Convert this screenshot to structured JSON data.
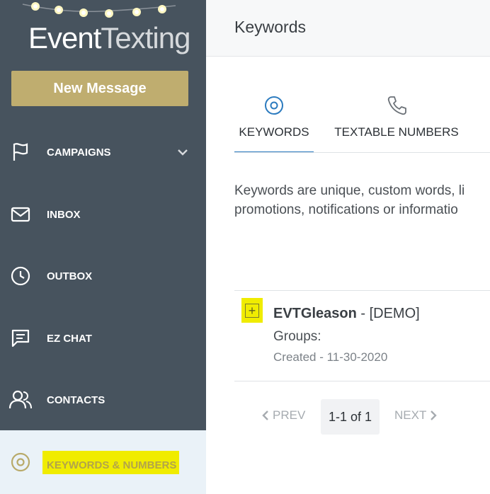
{
  "sidebar": {
    "logo_bold": "Event",
    "logo_light": "Texting",
    "new_message": "New Message",
    "items": [
      {
        "label": "CAMPAIGNS",
        "icon": "flag-icon"
      },
      {
        "label": "INBOX",
        "icon": "envelope-icon"
      },
      {
        "label": "OUTBOX",
        "icon": "clock-icon"
      },
      {
        "label": "EZ CHAT",
        "icon": "chat-icon"
      },
      {
        "label": "CONTACTS",
        "icon": "contacts-icon"
      },
      {
        "label": "KEYWORDS & NUMBERS",
        "icon": "target-icon"
      }
    ]
  },
  "header": {
    "title": "Keywords"
  },
  "tabs": [
    {
      "label": "KEYWORDS",
      "icon": "target-icon"
    },
    {
      "label": "TEXTABLE NUMBERS",
      "icon": "phone-icon"
    }
  ],
  "description": {
    "line1": "Keywords are unique, custom words, li",
    "line2": "promotions, notifications or informatio"
  },
  "keyword": {
    "name": "EVTGleason",
    "tag": " - [DEMO]",
    "groups": "Groups:",
    "created": "Created - 11-30-2020"
  },
  "pager": {
    "prev": "PREV",
    "info": "1-1 of 1",
    "next": "NEXT"
  },
  "colors": {
    "sidebar": "#47535e",
    "accent_gold": "#bfad6f",
    "highlight": "#f0ec00",
    "tab_active": "#2c7bbf"
  }
}
